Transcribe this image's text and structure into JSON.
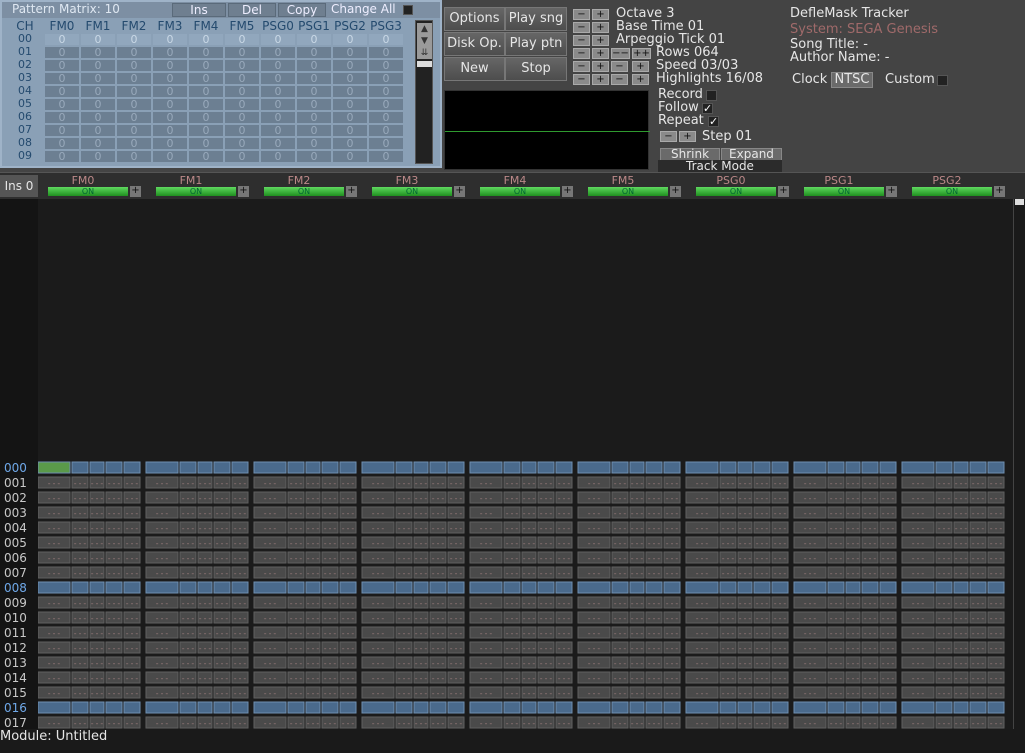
{
  "matrix": {
    "title": "Pattern Matrix: 10",
    "btn_ins": "Ins",
    "btn_del": "Del",
    "btn_copy": "Copy",
    "change_all": "Change All",
    "columns": [
      "CH",
      "FM0",
      "FM1",
      "FM2",
      "FM3",
      "FM4",
      "FM5",
      "PSG0",
      "PSG1",
      "PSG2",
      "PSG3"
    ],
    "rows": [
      {
        "label": "00",
        "cells": [
          "0",
          "0",
          "0",
          "0",
          "0",
          "0",
          "0",
          "0",
          "0",
          "0"
        ]
      },
      {
        "label": "01",
        "cells": [
          "0",
          "0",
          "0",
          "0",
          "0",
          "0",
          "0",
          "0",
          "0",
          "0"
        ]
      },
      {
        "label": "02",
        "cells": [
          "0",
          "0",
          "0",
          "0",
          "0",
          "0",
          "0",
          "0",
          "0",
          "0"
        ]
      },
      {
        "label": "03",
        "cells": [
          "0",
          "0",
          "0",
          "0",
          "0",
          "0",
          "0",
          "0",
          "0",
          "0"
        ]
      },
      {
        "label": "04",
        "cells": [
          "0",
          "0",
          "0",
          "0",
          "0",
          "0",
          "0",
          "0",
          "0",
          "0"
        ]
      },
      {
        "label": "05",
        "cells": [
          "0",
          "0",
          "0",
          "0",
          "0",
          "0",
          "0",
          "0",
          "0",
          "0"
        ]
      },
      {
        "label": "06",
        "cells": [
          "0",
          "0",
          "0",
          "0",
          "0",
          "0",
          "0",
          "0",
          "0",
          "0"
        ]
      },
      {
        "label": "07",
        "cells": [
          "0",
          "0",
          "0",
          "0",
          "0",
          "0",
          "0",
          "0",
          "0",
          "0"
        ]
      },
      {
        "label": "08",
        "cells": [
          "0",
          "0",
          "0",
          "0",
          "0",
          "0",
          "0",
          "0",
          "0",
          "0"
        ]
      },
      {
        "label": "09",
        "cells": [
          "0",
          "0",
          "0",
          "0",
          "0",
          "0",
          "0",
          "0",
          "0",
          "0"
        ]
      }
    ]
  },
  "transport": {
    "options": "Options",
    "play_song": "Play sng",
    "disk_op": "Disk Op.",
    "play_pattern": "Play ptn",
    "new": "New",
    "stop": "Stop"
  },
  "params": {
    "octave": "Octave 3",
    "base_time": "Base Time 01",
    "arpeggio_tick": "Arpeggio Tick 01",
    "rows": "Rows 064",
    "speed": "Speed 03/03",
    "highlights": "Highlights 16/08",
    "record": "Record",
    "follow": "Follow",
    "repeat": "Repeat",
    "follow_check": "✓",
    "repeat_check": "✓",
    "step": "Step 01",
    "shrink": "Shrink",
    "expand": "Expand",
    "track_mode": "Track Mode",
    "minus": "−",
    "plus": "+",
    "minus2": "−−",
    "plus2": "++"
  },
  "info": {
    "app_title": "DefleMask Tracker",
    "system": "System: SEGA Genesis",
    "song_title": "Song Title: -",
    "author": "Author Name: -",
    "clock": "Clock",
    "clock_value": "NTSC",
    "custom": "Custom"
  },
  "channels": {
    "ins_label": "Ins 0",
    "on_label": "ON",
    "names": [
      "FM0",
      "FM1",
      "FM2",
      "FM3",
      "FM4",
      "FM5",
      "PSG0",
      "PSG1",
      "PSG2"
    ]
  },
  "pattern": {
    "row_labels": [
      "000",
      "001",
      "002",
      "003",
      "004",
      "005",
      "006",
      "007",
      "008",
      "009",
      "010",
      "011",
      "012",
      "013",
      "014",
      "015",
      "016",
      "017"
    ],
    "empty_note": "---"
  },
  "status": {
    "module": "Module: Untitled"
  },
  "colors": {
    "matrix_bg": "#8aa0b6",
    "row_highlight": "#6fa8e8",
    "on_green": "#3fbf3f"
  }
}
